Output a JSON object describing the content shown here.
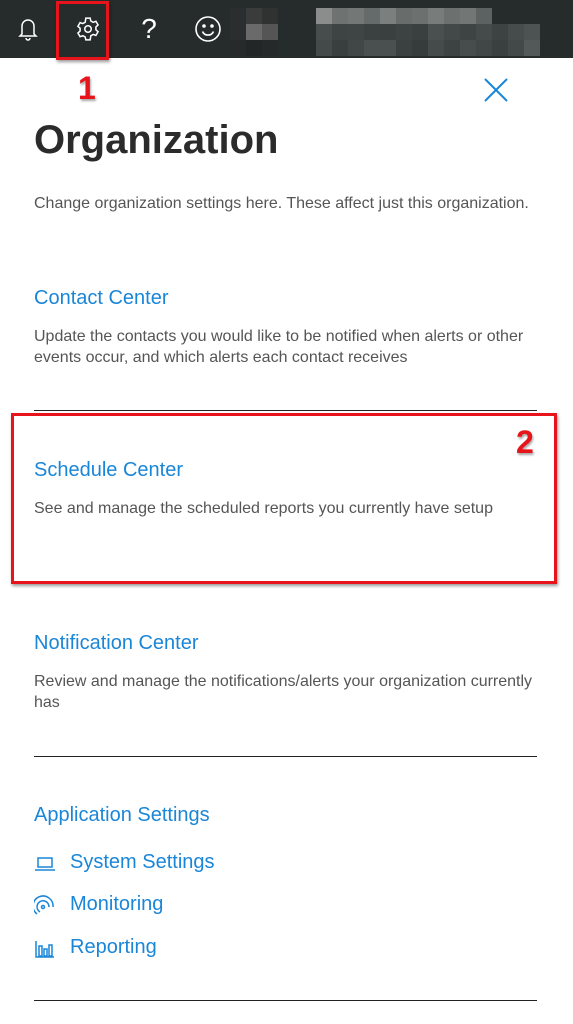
{
  "topbar": {
    "icons": [
      "bell-icon",
      "gear-icon",
      "help-icon",
      "smiley-icon"
    ]
  },
  "annotations": {
    "one": "1",
    "two": "2",
    "color": "#e8141c"
  },
  "panel": {
    "title": "Organization",
    "description": "Change organization settings here. These affect just this organization.",
    "sections": [
      {
        "label": "Contact Center",
        "description": "Update the contacts you would like to be notified when alerts or other events occur, and which alerts each contact receives"
      },
      {
        "label": "Schedule Center",
        "description": "See and manage the scheduled reports you currently have setup"
      },
      {
        "label": "Notification Center",
        "description": "Review and manage the notifications/alerts your organization currently has"
      }
    ],
    "app_settings": {
      "label": "Application Settings",
      "items": [
        {
          "label": "System Settings",
          "icon": "laptop-icon"
        },
        {
          "label": "Monitoring",
          "icon": "signal-icon"
        },
        {
          "label": "Reporting",
          "icon": "bar-chart-icon"
        }
      ]
    }
  },
  "colors": {
    "accent": "#1a86d8",
    "topbar": "#262b2b"
  }
}
